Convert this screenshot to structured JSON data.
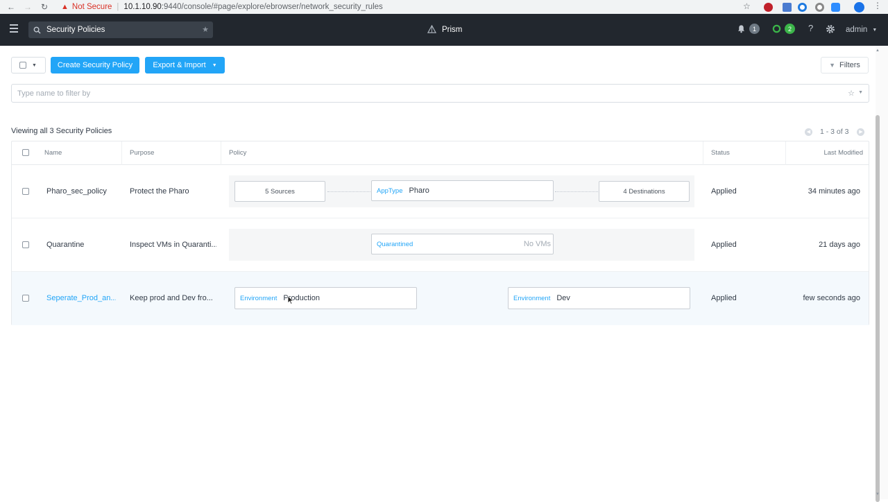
{
  "browser": {
    "not_secure": "Not Secure",
    "url_host": "10.1.10.90",
    "url_path": ":9440/console/#page/explore/ebrowser/network_security_rules"
  },
  "header": {
    "search_text": "Security Policies",
    "app_name": "Prism",
    "alerts_count": "1",
    "tasks_count": "2",
    "user": "admin"
  },
  "toolbar": {
    "create_label": "Create Security Policy",
    "export_label": "Export & Import",
    "filters_label": "Filters"
  },
  "filter": {
    "placeholder": "Type name to filter by"
  },
  "summary": {
    "viewing": "Viewing all 3 Security Policies",
    "page_range": "1 - 3 of 3"
  },
  "table": {
    "columns": [
      "Name",
      "Purpose",
      "Policy",
      "Status",
      "Last Modified"
    ],
    "rows": [
      {
        "name": "Pharo_sec_policy",
        "purpose": "Protect the Pharo",
        "sources": "5 Sources",
        "center_tag": "AppType",
        "center_value": "Pharo",
        "destinations": "4 Destinations",
        "status": "Applied",
        "modified": "34 minutes ago"
      },
      {
        "name": "Quarantine",
        "purpose": "Inspect VMs in Quaranti...",
        "center_tag": "Quarantined",
        "center_value": "No VMs",
        "status": "Applied",
        "modified": "21 days ago"
      },
      {
        "name": "Seperate_Prod_an...",
        "purpose": "Keep prod and Dev fro...",
        "left_tag": "Environment",
        "left_value": "Production",
        "right_tag": "Environment",
        "right_value": "Dev",
        "status": "Applied",
        "modified": "few seconds ago"
      }
    ]
  },
  "colors": {
    "accent": "#22a5f7",
    "header_bg": "#22272e",
    "status_green": "#3bb549"
  }
}
